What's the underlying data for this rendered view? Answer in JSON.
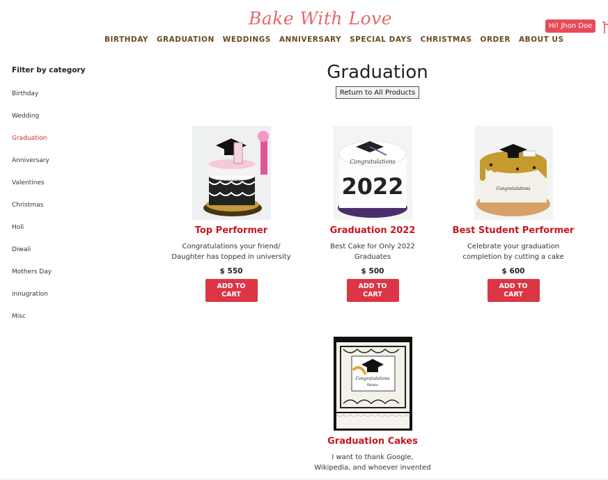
{
  "header": {
    "brand": "Bake With Love",
    "nav": [
      "BIRTHDAY",
      "GRADUATION",
      "WEDDINGS",
      "ANNIVERSARY",
      "SPECIAL DAYS",
      "CHRISTMAS",
      "ORDER",
      "ABOUT US"
    ],
    "user_greeting": "Hi! Jhon Doe",
    "cart_icon": "cart-icon"
  },
  "sidebar": {
    "heading": "Filter by category",
    "items": [
      "Birthday",
      "Wedding",
      "Graduation",
      "Anniversary",
      "Valentines",
      "Christmas",
      "Holi",
      "Diwali",
      "Mothers Day",
      "innugration",
      "Misc"
    ],
    "active": "Graduation"
  },
  "main": {
    "title": "Graduation",
    "return_label": "Return to All Products",
    "products": [
      {
        "name": "Top Performer",
        "desc_lines": [
          "Congratulations your friend/",
          "Daughter has topped in university"
        ],
        "price": "$ 550",
        "button_lines": [
          "ADD TO",
          "CART"
        ]
      },
      {
        "name": "Graduation 2022",
        "desc_lines": [
          "Best Cake for Only 2022",
          "Graduates"
        ],
        "price": "$ 500",
        "button_lines": [
          "ADD TO",
          "CART"
        ]
      },
      {
        "name": "Best Student Performer",
        "desc_lines": [
          "Celebrate your graduation",
          "completion by cutting a cake"
        ],
        "price": "$ 600",
        "button_lines": [
          "ADD TO",
          "CART"
        ]
      },
      {
        "name": "Graduation Cakes",
        "desc_lines": [
          "I want to thank Google,",
          "Wikipedia, and whoever invented"
        ]
      }
    ],
    "image_texts": {
      "p1": "Congratulations",
      "p2_top": "Congratulations",
      "p2_year": "2022",
      "p3": "Congratulations",
      "p4_title": "Congratulations",
      "p4_name": "Kalatu"
    }
  },
  "colors": {
    "brand": "#e7676c",
    "nav": "#6a4a1c",
    "accent": "#dc3545",
    "product_title": "#c8161d",
    "active": "#d42a2a"
  }
}
